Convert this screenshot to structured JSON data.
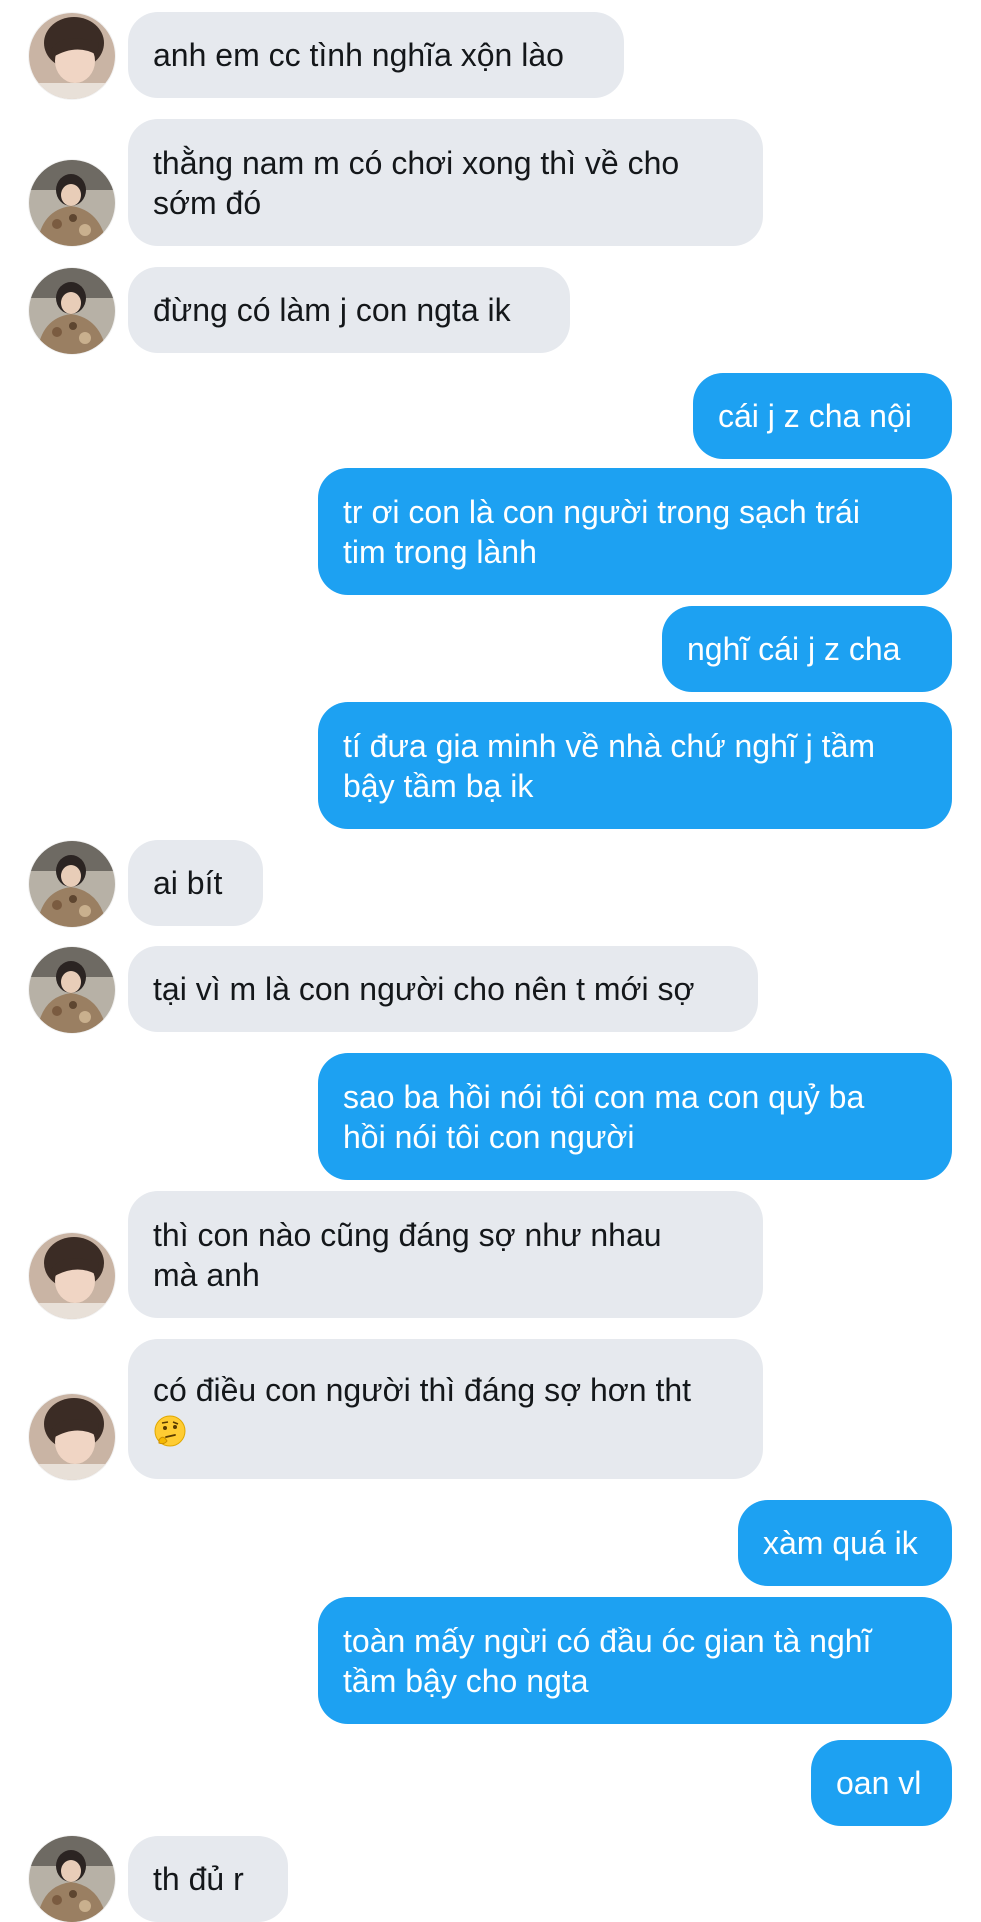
{
  "messages": [
    {
      "from": "them",
      "avatar": "avatar-girl",
      "lines": [
        "anh em cc tình nghĩa xộn lào"
      ]
    },
    {
      "from": "them",
      "avatar": "avatar-jacket",
      "lines": [
        "thằng nam m có chơi xong thì về cho",
        "sớm đó"
      ]
    },
    {
      "from": "them",
      "avatar": "avatar-jacket",
      "lines": [
        "đừng có làm j con ngta ik"
      ]
    },
    {
      "from": "me",
      "lines": [
        "cái j z cha nội"
      ]
    },
    {
      "from": "me",
      "lines": [
        "tr ơi con là con người trong sạch trái",
        "tim trong lành"
      ]
    },
    {
      "from": "me",
      "lines": [
        "nghĩ cái j z cha"
      ]
    },
    {
      "from": "me",
      "lines": [
        "tí đưa gia minh về nhà chứ nghĩ j tầm",
        "bậy tầm bạ ik"
      ]
    },
    {
      "from": "them",
      "avatar": "avatar-jacket",
      "lines": [
        "ai bít"
      ]
    },
    {
      "from": "them",
      "avatar": "avatar-jacket",
      "lines": [
        "tại vì m là con người cho nên t mới sợ"
      ]
    },
    {
      "from": "me",
      "lines": [
        "sao ba hồi nói tôi con ma con quỷ ba",
        "hồi nói tôi con người"
      ]
    },
    {
      "from": "them",
      "avatar": "avatar-girl",
      "lines": [
        "thì con nào cũng đáng sợ như nhau",
        "mà anh"
      ]
    },
    {
      "from": "them",
      "avatar": "avatar-girl",
      "lines": [
        "có điều con người thì đáng sợ hơn tht"
      ],
      "emoji": "thinking-face-icon"
    },
    {
      "from": "me",
      "lines": [
        "xàm quá ik"
      ]
    },
    {
      "from": "me",
      "lines": [
        "toàn mấy ngừi có đầu óc gian tà nghĩ",
        "tầm bậy cho ngta"
      ]
    },
    {
      "from": "me",
      "lines": [
        "oan vl"
      ]
    },
    {
      "from": "them",
      "avatar": "avatar-jacket",
      "lines": [
        "th đủ r"
      ]
    }
  ],
  "colors": {
    "incoming_bubble": "#e6e9ee",
    "outgoing_bubble": "#1da1f2",
    "incoming_text": "#14171a",
    "outgoing_text": "#ffffff"
  }
}
